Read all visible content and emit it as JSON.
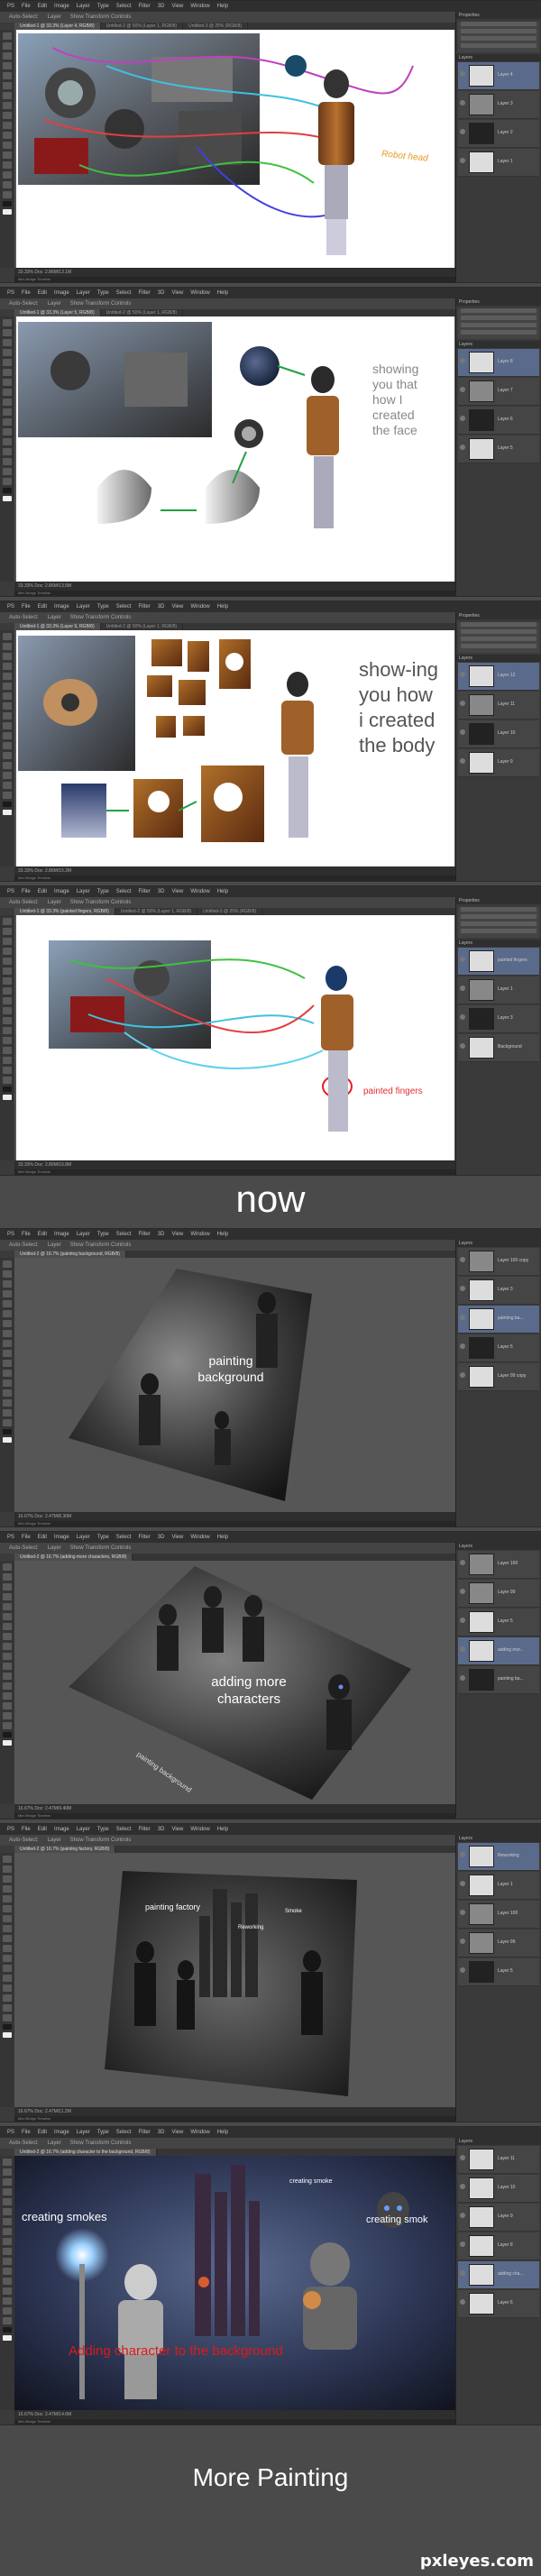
{
  "menus": [
    "PS",
    "File",
    "Edit",
    "Image",
    "Layer",
    "Type",
    "Select",
    "Filter",
    "3D",
    "View",
    "Window",
    "Help"
  ],
  "options": [
    "Auto-Select:",
    "Layer",
    "Show Transform Controls"
  ],
  "panels": [
    {
      "tabs": [
        "Untitled-1 @ 33.3% (Layer 4, RGB/8)",
        "Untitled-2 @ 50% (Layer 1, RGB/8)",
        "Untitled-3 @ 25% (RGB/8)"
      ],
      "status": "33.33%   Doc: 2.86M/13.1M",
      "status_tab": "Mini Bridge   Timeline",
      "annotations": [
        "Robot head"
      ],
      "layers": [
        "Layer 4",
        "Layer 3",
        "Layer 2",
        "Layer 1"
      ]
    },
    {
      "tabs": [
        "Untitled-1 @ 33.3% (Layer 5, RGB/8)",
        "Untitled-2 @ 50% (Layer 1, RGB/8)"
      ],
      "status": "33.33%   Doc: 2.86M/13.5M",
      "status_tab": "Mini Bridge   Timeline",
      "annotations": [
        "showing you that how I created the face"
      ],
      "layers": [
        "Layer 8",
        "Layer 7",
        "Layer 6",
        "Layer 5"
      ]
    },
    {
      "tabs": [
        "Untitled-1 @ 33.3% (Layer 9, RGB/8)",
        "Untitled-2 @ 50% (Layer 1, RGB/8)"
      ],
      "status": "33.33%   Doc: 2.86M/15.2M",
      "status_tab": "Mini Bridge   Timeline",
      "annotations": [
        "show-ing you how i created the body"
      ],
      "layers": [
        "Layer 12",
        "Layer 11",
        "Layer 10",
        "Layer 9"
      ]
    },
    {
      "tabs": [
        "Untitled-1 @ 33.3% (painted fingers, RGB/8)",
        "Untitled-2 @ 50% (Layer 1, RGB/8)",
        "Untitled-3 @ 25% (RGB/8)"
      ],
      "status": "33.33%   Doc: 2.86M/16.8M",
      "status_tab": "Mini Bridge   Timeline",
      "annotations": [
        "painted fingers"
      ],
      "layers": [
        "painted fingers",
        "Layer 1",
        "Layer 3",
        "Background"
      ]
    }
  ],
  "between_caption": "now",
  "panels_b": [
    {
      "tabs": [
        "Untitled-2 @ 16.7% (painting background, RGB/8)"
      ],
      "status": "16.67%   Doc: 2.47M/8.30M",
      "status_tab": "Mini Bridge   Timeline",
      "annotations": [
        "painting background"
      ],
      "layers": [
        "Layer 100 copy",
        "Layer 3",
        "painting ba...",
        "Layer 5",
        "Layer 99 copy"
      ]
    },
    {
      "tabs": [
        "Untitled-2 @ 16.7% (adding more characters, RGB/8)"
      ],
      "status": "16.67%   Doc: 2.47M/9.40M",
      "status_tab": "Mini Bridge   Timeline",
      "annotations": [
        "adding more characters",
        "painting background"
      ],
      "layers": [
        "Layer 100",
        "Layer 99",
        "Layer 5",
        "adding mor...",
        "painting ba..."
      ]
    },
    {
      "tabs": [
        "Untitled-2 @ 16.7% (painting factory, RGB/8)"
      ],
      "status": "16.67%   Doc: 2.47M/11.2M",
      "status_tab": "Mini Bridge   Timeline",
      "annotations": [
        "painting factory",
        "Reworking",
        "Smoke"
      ],
      "layers": [
        "Reworking",
        "Layer 1",
        "Layer 100",
        "Layer 99",
        "Layer 5"
      ]
    },
    {
      "tabs": [
        "Untitled-2 @ 16.7% (adding character to the background, RGB/8)"
      ],
      "status": "16.67%   Doc: 2.47M/14.6M",
      "status_tab": "Mini Bridge   Timeline",
      "annotations": [
        "creating smokes",
        "creating smoke",
        "creating smok",
        "Adding character to the background"
      ],
      "layers": [
        "Layer 11",
        "Layer 10",
        "Layer 9",
        "Layer 8",
        "adding cha...",
        "Layer 6"
      ]
    }
  ],
  "final_caption": "More Painting",
  "watermark": "pxleyes.com"
}
